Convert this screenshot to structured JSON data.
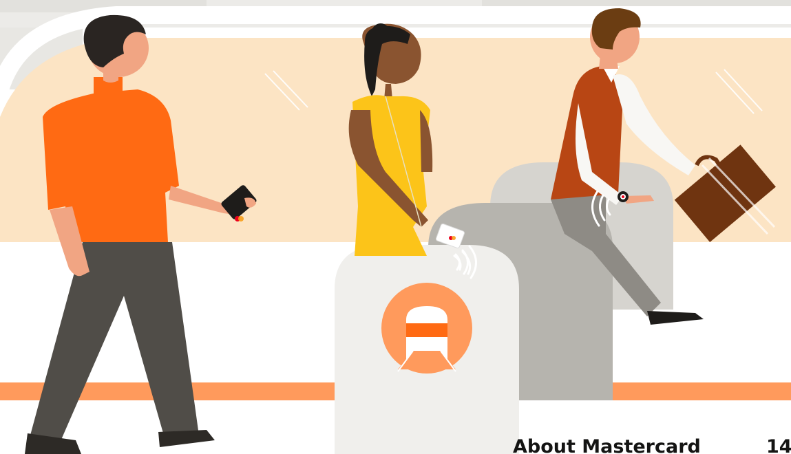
{
  "footer": {
    "title": "About Mastercard",
    "page_number": "14"
  },
  "colors": {
    "wall_band": "#fce4c4",
    "stripe": "#ff9a5c",
    "orange_shirt": "#ff6a13",
    "yellow_dress": "#fcc419",
    "vest": "#b84614",
    "briefcase": "#6f3410",
    "gate_front": "#f0efec",
    "gate_mid": "#b6b4ae",
    "gate_back": "#d6d4cf",
    "text": "#141413"
  }
}
